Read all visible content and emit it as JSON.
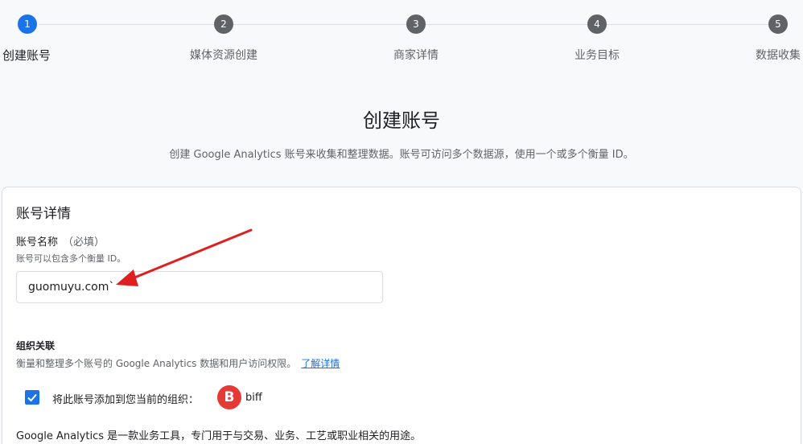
{
  "stepper": {
    "steps": [
      {
        "number": "1",
        "label": "创建账号"
      },
      {
        "number": "2",
        "label": "媒体资源创建"
      },
      {
        "number": "3",
        "label": "商家详情"
      },
      {
        "number": "4",
        "label": "业务目标"
      },
      {
        "number": "5",
        "label": "数据收集"
      }
    ],
    "active_step": 1
  },
  "header": {
    "title": "创建账号",
    "subtitle": "创建 Google Analytics 账号来收集和整理数据。账号可访问多个数据源，使用一个或多个衡量 ID。"
  },
  "account_details": {
    "section_title": "账号详情",
    "name_label": "账号名称",
    "required_note": "（必填）",
    "name_hint": "账号可以包含多个衡量 ID。",
    "name_value": "guomuyu.com`"
  },
  "organization": {
    "title": "组织关联",
    "description": "衡量和整理多个账号的 Google Analytics 数据和用户访问权限。",
    "learn_more": "了解详情",
    "checkbox_label": "将此账号添加到您当前的组织：",
    "checkbox_checked": true,
    "org_avatar_letter": "B",
    "org_name": "biff"
  },
  "footer_text": "Google Analytics 是一款业务工具，专门用于与交易、业务、工艺或职业相关的用途。",
  "colors": {
    "accent": "#1a73e8",
    "inactive_step": "#5f6368",
    "avatar": "#e53935",
    "annotation_arrow": "#e02020"
  }
}
